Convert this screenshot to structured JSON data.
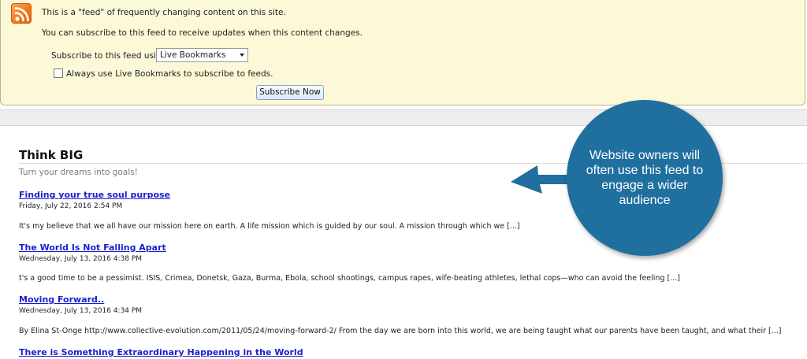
{
  "feed_header": {
    "icon": "rss-feed-icon",
    "line1": "This is a \"feed\" of frequently changing content on this site.",
    "line2": "You can subscribe to this feed to receive updates when this content changes.",
    "subscribe_label": "Subscribe to this feed using",
    "subscribe_select_value": "Live Bookmarks",
    "always_use_label": "Always use Live Bookmarks to subscribe to feeds.",
    "always_use_checked": false,
    "subscribe_button": "Subscribe Now",
    "background_color": "#fcf9d8"
  },
  "blog": {
    "title": "Think BIG",
    "subtitle": "Turn your dreams into goals!",
    "link_color": "#1a1fd0",
    "entries": [
      {
        "title": "Finding your true soul purpose",
        "date": "Friday, July 22, 2016 2:54 PM",
        "summary": "It's my believe that we all have our mission here on earth. A life mission which is guided by our soul. A mission through which we [...]"
      },
      {
        "title": "The World Is Not Falling Apart",
        "date": "Wednesday, July 13, 2016 4:38 PM",
        "summary": "t's a good time to be a pessimist. ISIS, Crimea, Donetsk, Gaza, Burma, Ebola, school shootings, campus rapes, wife-beating athletes, lethal cops—who can avoid the feeling [...]"
      },
      {
        "title": "Moving Forward..",
        "date": "Wednesday, July 13, 2016 4:34 PM",
        "summary": "By Elina St-Onge http://www.collective-evolution.com/2011/05/24/moving-forward-2/ From the day we are born into this world, we are being taught what our parents have been taught, and what their [...]"
      },
      {
        "title": "There is Something Extraordinary Happening in the World"
      }
    ]
  },
  "callout": {
    "text": "Website owners will often use this feed to engage a wider audience",
    "color": "#1f6f9f",
    "icon": "left-arrow-icon"
  }
}
